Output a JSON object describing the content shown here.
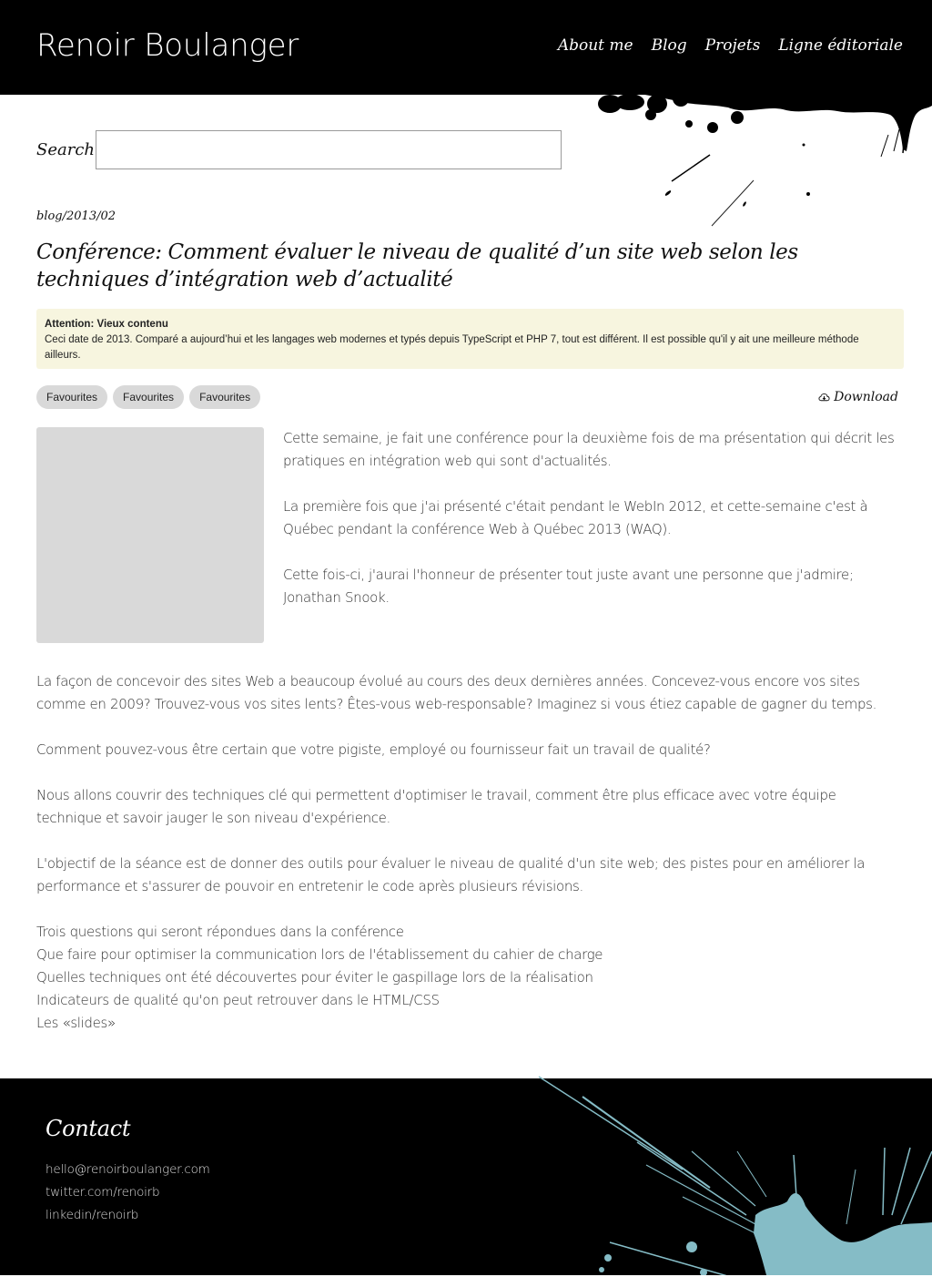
{
  "header": {
    "site_title": "Renoir Boulanger",
    "nav": [
      {
        "label": "About me"
      },
      {
        "label": "Blog"
      },
      {
        "label": "Projets"
      },
      {
        "label": "Ligne éditoriale"
      }
    ]
  },
  "search": {
    "label": "Search",
    "value": "",
    "placeholder": ""
  },
  "breadcrumb": "blog/2013/02",
  "post": {
    "title": "Conférence: Comment évaluer le niveau de qualité d’un site web selon les techniques d’intégration web d’actualité",
    "notice": {
      "title": "Attention: Vieux contenu",
      "text": "Ceci date de 2013. Comparé a aujourd’hui et les langages web modernes et typés depuis TypeScript et PHP 7, tout est différent. Il est possible qu'il y ait une meilleure méthode ailleurs."
    },
    "tags": [
      {
        "label": "Favourites"
      },
      {
        "label": "Favourites"
      },
      {
        "label": "Favourites"
      }
    ],
    "download": {
      "label": "Download",
      "icon": "cloud-download-icon"
    },
    "intro_paragraphs": [
      "Cette semaine, je fait une conférence pour la deuxième fois de ma présentation qui décrit les pratiques en intégration web qui sont d'actualités.",
      "La première fois que j'ai présenté c'était pendant le WebIn 2012, et cette-semaine c'est à Québec pendant la conférence Web à Québec 2013 (WAQ).",
      "Cette fois-ci, j'aurai l'honneur de présenter tout juste avant une personne que j'admire; Jonathan Snook."
    ],
    "paragraphs": [
      "La façon de concevoir des sites Web a beaucoup évolué au cours des deux dernières années. Concevez-vous encore vos sites comme en 2009? Trouvez-vous vos sites lents? Êtes-vous web-responsable? Imaginez si vous étiez capable de gagner du temps.",
      "Comment pouvez-vous être certain que votre pigiste, employé ou fournisseur fait un travail de qualité?",
      "Nous allons couvrir des techniques clé qui permettent d'optimiser le travail, comment être plus efficace avec votre équipe technique et savoir jauger le son niveau d'expérience.",
      "L'objectif de la séance est de donner des outils pour évaluer le niveau de qualité d'un site web; des pistes pour en améliorer la performance et s'assurer de pouvoir en entretenir le code après plusieurs révisions."
    ],
    "list_lines": [
      "Trois questions qui seront répondues dans la conférence",
      "Que faire pour optimiser la communication lors de l'établissement du cahier de charge",
      "Quelles techniques ont été découvertes pour éviter le gaspillage lors de la réalisation",
      "Indicateurs de qualité qu'on peut retrouver dans le HTML/CSS",
      "Les «slides»"
    ]
  },
  "footer": {
    "title": "Contact",
    "links": [
      {
        "label": "hello@renoirboulanger.com"
      },
      {
        "label": "twitter.com/renoirb"
      },
      {
        "label": "linkedin/renoirb"
      }
    ]
  },
  "colors": {
    "header_bg": "#000000",
    "notice_bg": "#f7f5df",
    "tag_bg": "#d9d9d9",
    "splatter_accent": "#85bcc6"
  }
}
